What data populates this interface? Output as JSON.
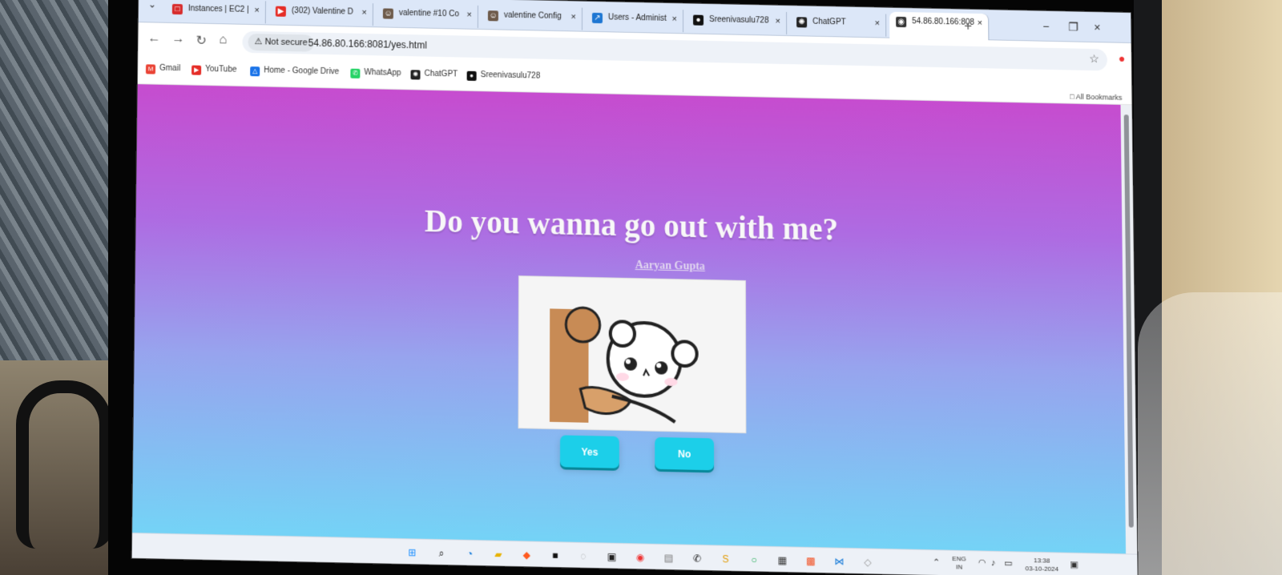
{
  "browser": {
    "tabs": [
      {
        "label": "Instances | EC2 |",
        "icon": "aws-icon",
        "color": "#d72b2b"
      },
      {
        "label": "(302) Valentine D",
        "icon": "youtube-icon",
        "color": "#e52d27"
      },
      {
        "label": "valentine #10 Co",
        "icon": "jenkins-icon",
        "color": "#6d5a4a"
      },
      {
        "label": "valentine Config",
        "icon": "jenkins-icon",
        "color": "#6d5a4a"
      },
      {
        "label": "Users - Administ",
        "icon": "app-icon",
        "color": "#1d76d2"
      },
      {
        "label": "Sreenivasulu728",
        "icon": "github-icon",
        "color": "#111111"
      },
      {
        "label": "ChatGPT",
        "icon": "chatgpt-icon",
        "color": "#222222"
      },
      {
        "label": "54.86.80.166:808",
        "icon": "globe-icon",
        "color": "#333333"
      }
    ],
    "new_tab": "+",
    "window_controls": {
      "minimize": "−",
      "restore": "❐",
      "close": "×"
    },
    "address": {
      "security": "Not secure",
      "url": "54.86.80.166:8081/yes.html"
    },
    "bookmarks": [
      {
        "label": "Gmail",
        "icon": "gmail-icon",
        "color": "#ea4335"
      },
      {
        "label": "YouTube",
        "icon": "youtube-icon",
        "color": "#e52d27"
      },
      {
        "label": "Home - Google Drive",
        "icon": "drive-icon",
        "color": "#1a73e8"
      },
      {
        "label": "WhatsApp",
        "icon": "whatsapp-icon",
        "color": "#25d366"
      },
      {
        "label": "ChatGPT",
        "icon": "chatgpt-icon",
        "color": "#222222"
      },
      {
        "label": "Sreenivasulu728",
        "icon": "github-icon",
        "color": "#111111"
      }
    ],
    "all_bookmarks": "All Bookmarks"
  },
  "page": {
    "title": "Do you wanna go out with me?",
    "author": "Aaryan Gupta",
    "yes_button": "Yes",
    "no_button": "No"
  },
  "taskbar": {
    "lang_top": "ENG",
    "lang_bottom": "IN",
    "time": "13:38",
    "date": "03-10-2024"
  }
}
